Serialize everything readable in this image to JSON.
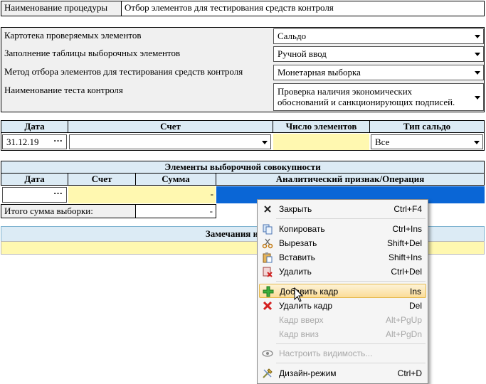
{
  "header": {
    "proc_label": "Наименование процедуры",
    "proc_value": "Отбор элементов для тестирования средств контроля"
  },
  "settings": [
    {
      "label": "Картотека проверяемых элементов",
      "value": "Сальдо"
    },
    {
      "label": "Заполнение таблицы выборочных элементов",
      "value": "Ручной ввод"
    },
    {
      "label": "Метод отбора элементов для тестирования средств контроля",
      "value": "Монетарная выборка"
    },
    {
      "label": "Наименование теста контроля",
      "value_line1": "Проверка наличия  экономических",
      "value_line2": "обоснований и санкционирующих подписей."
    }
  ],
  "filter": {
    "col_date": "Дата",
    "col_account": "Счет",
    "col_count": "Число элементов",
    "col_balance_type": "Тип сальдо",
    "date_value": "31.12.19",
    "account_value": "",
    "count_value": "",
    "balance_type_value": "Все"
  },
  "sample": {
    "title": "Элементы выборочной совокупности",
    "col_date": "Дата",
    "col_account": "Счет",
    "col_sum": "Сумма",
    "col_attr": "Аналитический признак/Операция",
    "row_sum": "-",
    "total_label": "Итого сумма выборки:",
    "total_value": "-"
  },
  "remarks": {
    "title": "Замечания и реко"
  },
  "context_menu": {
    "items": [
      {
        "label": "Закрыть",
        "shortcut": "Ctrl+F4",
        "icon": "close-icon",
        "enabled": true
      },
      {
        "label": "Копировать",
        "shortcut": "Ctrl+Ins",
        "icon": "copy-icon",
        "enabled": true
      },
      {
        "label": "Вырезать",
        "shortcut": "Shift+Del",
        "icon": "cut-icon",
        "enabled": true
      },
      {
        "label": "Вставить",
        "shortcut": "Shift+Ins",
        "icon": "paste-icon",
        "enabled": true
      },
      {
        "label": "Удалить",
        "shortcut": "Ctrl+Del",
        "icon": "delete-icon",
        "enabled": true
      },
      {
        "label": "Добавить кадр",
        "shortcut": "Ins",
        "icon": "add-frame-icon",
        "enabled": true,
        "highlighted": true
      },
      {
        "label": "Удалить кадр",
        "shortcut": "Del",
        "icon": "delete-frame-icon",
        "enabled": true
      },
      {
        "label": "Кадр вверх",
        "shortcut": "Alt+PgUp",
        "icon": "",
        "enabled": false
      },
      {
        "label": "Кадр вниз",
        "shortcut": "Alt+PgDn",
        "icon": "",
        "enabled": false
      },
      {
        "label": "Настроить видимость...",
        "shortcut": "",
        "icon": "eye-icon",
        "enabled": false
      },
      {
        "label": "Дизайн-режим",
        "shortcut": "Ctrl+D",
        "icon": "design-mode-icon",
        "enabled": true
      }
    ]
  },
  "colors": {
    "selection": "#0a66d6",
    "yellow_field": "#fff8b0",
    "header_blue": "#dcebf5",
    "menu_highlight": "#fbdc98"
  }
}
